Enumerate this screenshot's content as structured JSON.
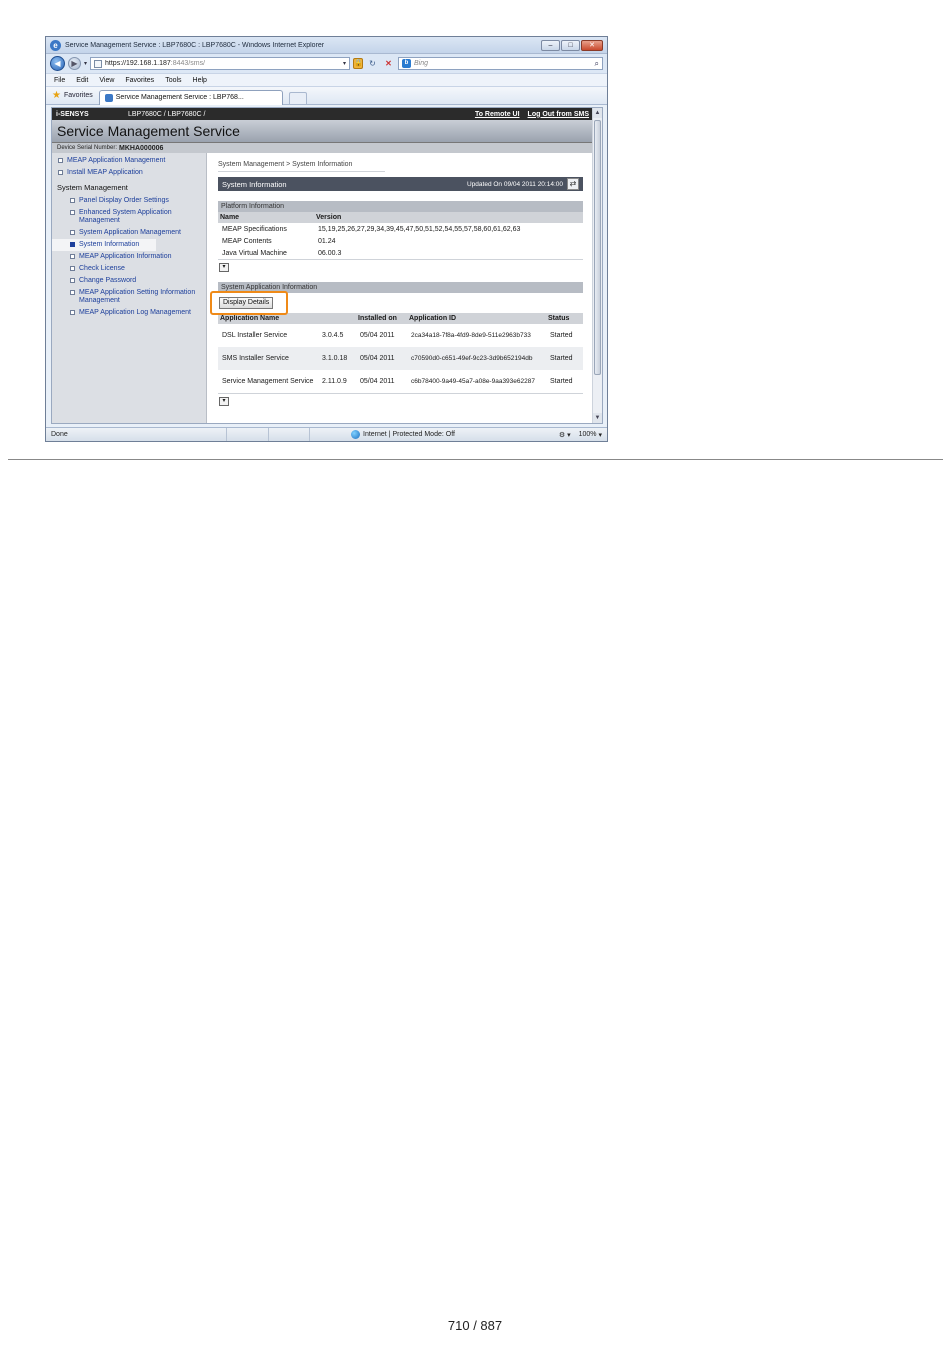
{
  "browser": {
    "window_title": "Service Management Service : LBP7680C : LBP7680C - Windows Internet Explorer",
    "url_main": "https://192.168.1.187",
    "url_rest": ":8443/sms/",
    "search_placeholder": "Bing",
    "menu": [
      "File",
      "Edit",
      "View",
      "Favorites",
      "Tools",
      "Help"
    ],
    "favorites_label": "Favorites",
    "tab_title": "Service Management Service : LBP768...",
    "status_done": "Done",
    "status_zone": "Internet | Protected Mode: Off",
    "zoom": "100%"
  },
  "sms": {
    "brand": "i-SENSYS",
    "model": "LBP7680C / LBP7680C /",
    "link_remote_ui": "To Remote UI",
    "link_logout": "Log Out from SMS",
    "header_title": "Service Management Service",
    "serial_label": "Device Serial Number:",
    "serial_value": "MKHA000006"
  },
  "nav": {
    "meap_app_mgmt": "MEAP Application Management",
    "install_meap": "Install MEAP Application",
    "system_mgmt": "System Management",
    "sub": [
      "Panel Display Order Settings",
      "Enhanced System Application Management",
      "System Application Management",
      "System Information",
      "MEAP Application Information",
      "Check License",
      "Change Password",
      "MEAP Application Setting Information Management",
      "MEAP Application Log Management"
    ]
  },
  "content": {
    "breadcrumb": "System Management > System Information",
    "section_title": "System Information",
    "updated": "Updated On 09/04 2011 20:14:00",
    "platform": {
      "title": "Platform Information",
      "col_name": "Name",
      "col_version": "Version",
      "rows": [
        [
          "MEAP Specifications",
          "15,19,25,26,27,29,34,39,45,47,50,51,52,54,55,57,58,60,61,62,63"
        ],
        [
          "MEAP Contents",
          "01.24"
        ],
        [
          "Java Virtual Machine",
          "06.00.3"
        ]
      ]
    },
    "sysapp": {
      "title": "System Application Information",
      "display_details": "Display Details",
      "col_name": "Application Name",
      "col_installed": "Installed on",
      "col_id": "Application ID",
      "col_status": "Status",
      "rows": [
        [
          "DSL Installer Service",
          "3.0.4.5",
          "05/04 2011",
          "2ca34a18-7f8a-4fd9-8de9-511e2963b733",
          "Started"
        ],
        [
          "SMS Installer Service",
          "3.1.0.18",
          "05/04 2011",
          "c70590d0-c651-49ef-9c23-3d9b652194db",
          "Started"
        ],
        [
          "Service Management Service",
          "2.11.0.9",
          "05/04 2011",
          "c6b78400-9a49-45a7-a08e-9aa393e62287",
          "Started"
        ]
      ]
    }
  },
  "footer": {
    "page_number": "710 / 887"
  },
  "colors": {
    "highlight": "#ef8a18",
    "nav_link": "#1d3f9b",
    "section_bar": "#4b5260"
  }
}
